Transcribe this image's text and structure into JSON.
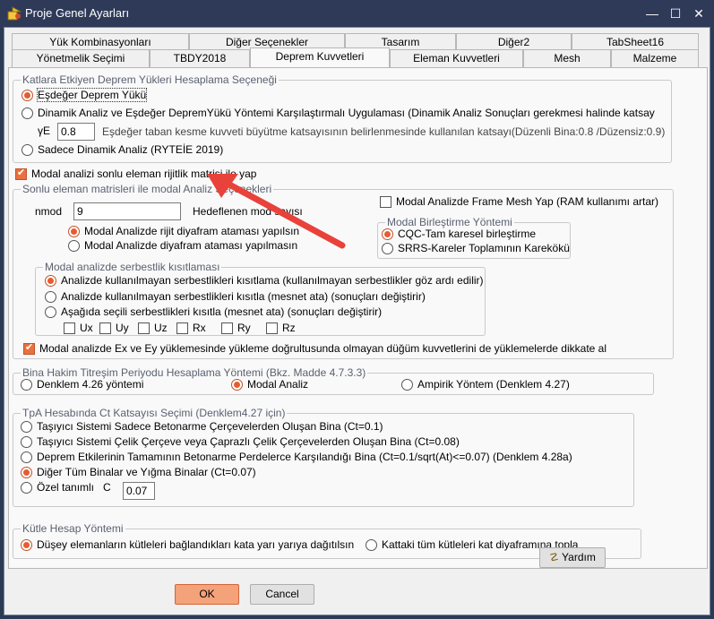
{
  "window": {
    "title": "Proje Genel Ayarları"
  },
  "tabs_top": [
    "Yük Kombinasyonları",
    "Diğer Seçenekler",
    "Tasarım",
    "Diğer2",
    "TabSheet16"
  ],
  "tabs_bottom": [
    "Yönetmelik Seçimi",
    "TBDY2018",
    "Deprem Kuvvetleri",
    "Eleman Kuvvetleri",
    "Mesh",
    "Malzeme"
  ],
  "active_tab": "Deprem Kuvvetleri",
  "group_load": {
    "legend": "Katlara Etkiyen Deprem Yükleri Hesaplama Seçeneği",
    "opt1": "Eşdeğer Deprem Yükü",
    "opt2": "Dinamik Analiz ve Eşdeğer DepremYükü Yöntemi Karşılaştırmalı Uygulaması (Dinamik Analiz Sonuçları gerekmesi halinde katsay",
    "gamma_label": "γE",
    "gamma_value": "0.8",
    "gamma_desc": "Eşdeğer taban kesme kuvveti büyütme katsayısının belirlenmesinde kullanılan katsayı(Düzenli Bina:0.8 /Düzensiz:0.9)",
    "opt3": "Sadece Dinamik Analiz (RYTEİE 2019)"
  },
  "modal_check": "Modal analizi sonlu eleman rijitlik matrisi ile yap",
  "group_fem": {
    "legend": "Sonlu eleman matrisleri ile modal Analiz Seçenekleri",
    "nmod_label": "nmod",
    "nmod_value": "9",
    "hedef_label": "Hedeflenen mod sayısı",
    "rigid_opt1": "Modal Analizde rijit diyafram ataması yapılsın",
    "rigid_opt2": "Modal Analizde diyafram ataması yapılmasın",
    "frame_mesh": "Modal Analizde Frame Mesh Yap (RAM kullanımı artar)",
    "combine_legend": "Modal Birleştirme Yöntemi",
    "cqc": "CQC-Tam karesel birleştirme",
    "srrs": "SRRS-Kareler Toplamının Karekökü",
    "dof_legend": "Modal analizde serbestlik kısıtlaması",
    "dof_opt1": "Analizde kullanılmayan serbestlikleri kısıtlama (kullanılmayan serbestlikler göz ardı edilir)",
    "dof_opt2": "Analizde kullanılmayan serbestlikleri kısıtla (mesnet ata) (sonuçları değiştirir)",
    "dof_opt3": "Aşağıda seçili serbestlikleri kısıtla  (mesnet ata) (sonuçları değiştirir)",
    "dofs": [
      "Ux",
      "Uy",
      "Uz",
      "Rx",
      "Ry",
      "Rz"
    ],
    "exey_check": "Modal analizde Ex ve  Ey yüklemesinde yükleme doğrultusunda olmayan düğüm kuvvetlerini de yüklemelerde dikkate al"
  },
  "group_period": {
    "legend": "Bina Hakim Titreşim Periyodu Hesaplama Yöntemi (Bkz. Madde 4.7.3.3)",
    "opt1": "Denklem 4.26 yöntemi",
    "opt2": "Modal Analiz",
    "opt3": "Ampirik Yöntem (Denklem 4.27)"
  },
  "group_ct": {
    "legend": "TpA Hesabında Ct Katsayısı Seçimi (Denklem4.27 için)",
    "opt1": "Taşıyıcı Sistemi Sadece Betonarme Çerçevelerden Oluşan Bina (Ct=0.1)",
    "opt2": "Taşıyıcı Sistemi Çelik Çerçeve veya Çaprazlı Çelik Çerçevelerden Oluşan Bina (Ct=0.08)",
    "opt3": "Deprem Etkilerinin Tamamının Betonarme Perdelerce Karşılandığı Bina (Ct=0.1/sqrt(At)<=0.07) (Denklem 4.28a)",
    "opt4": "Diğer Tüm Binalar ve Yığma Binalar (Ct=0.07)",
    "opt5": "Özel tanımlı",
    "ct_label": "C",
    "ct_value": "0.07"
  },
  "group_mass": {
    "legend": "Kütle Hesap Yöntemi",
    "opt1": "Düşey elemanların kütleleri bağlandıkları kata yarı yarıya dağıtılsın",
    "opt2": "Kattaki tüm kütleleri kat diyaframına topla"
  },
  "buttons": {
    "help": "Yardım",
    "ok": "OK",
    "cancel": "Cancel"
  },
  "colors": {
    "accent": "#e65c2e",
    "titlebar": "#2e3a58",
    "arrow": "#e8423a"
  }
}
